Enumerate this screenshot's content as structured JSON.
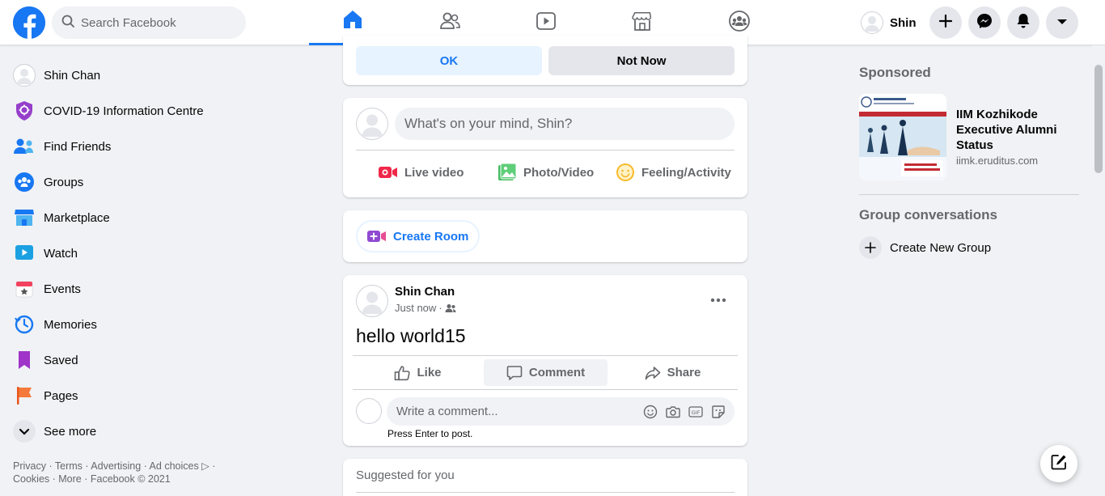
{
  "header": {
    "search": {
      "placeholder": "Search Facebook"
    },
    "nav_tabs": [
      {
        "name": "home",
        "active": true
      },
      {
        "name": "friends",
        "active": false
      },
      {
        "name": "watch",
        "active": false
      },
      {
        "name": "marketplace",
        "active": false
      },
      {
        "name": "groups",
        "active": false
      }
    ],
    "profile_name": "Shin",
    "actions": [
      "create-icon",
      "messenger-icon",
      "notifications-icon",
      "account-menu-icon"
    ]
  },
  "sidebar": {
    "items": [
      {
        "label": "Shin Chan",
        "icon": "profile-avatar"
      },
      {
        "label": "COVID-19 Information Centre",
        "icon": "covid-shield-icon"
      },
      {
        "label": "Find Friends",
        "icon": "friends-icon"
      },
      {
        "label": "Groups",
        "icon": "groups-icon"
      },
      {
        "label": "Marketplace",
        "icon": "marketplace-icon"
      },
      {
        "label": "Watch",
        "icon": "watch-icon"
      },
      {
        "label": "Events",
        "icon": "events-icon"
      },
      {
        "label": "Memories",
        "icon": "memories-icon"
      },
      {
        "label": "Saved",
        "icon": "saved-icon"
      },
      {
        "label": "Pages",
        "icon": "pages-icon"
      },
      {
        "label": "See more",
        "icon": "chevron-down-icon"
      }
    ],
    "footer": {
      "line1": "Privacy · Terms · Advertising · Ad choices ▷ ·",
      "line2": "Cookies · More · Facebook © 2021"
    }
  },
  "prompt_card": {
    "ok_label": "OK",
    "not_now_label": "Not Now"
  },
  "composer": {
    "placeholder": "What's on your mind, Shin?",
    "actions": [
      {
        "label": "Live video",
        "icon": "live-video-icon",
        "color": "#f02849"
      },
      {
        "label": "Photo/Video",
        "icon": "photo-video-icon",
        "color": "#45bd62"
      },
      {
        "label": "Feeling/Activity",
        "icon": "feeling-icon",
        "color": "#f7b928"
      }
    ]
  },
  "room": {
    "label": "Create Room"
  },
  "post": {
    "author": "Shin Chan",
    "time": "Just now",
    "text": "hello world15",
    "actions": {
      "like": "Like",
      "comment": "Comment",
      "share": "Share"
    },
    "comment_placeholder": "Write a comment...",
    "press_enter": "Press Enter to post."
  },
  "suggested": {
    "title": "Suggested for you"
  },
  "right": {
    "sponsored_title": "Sponsored",
    "ad": {
      "title": "IIM Kozhikode Executive Alumni Status",
      "url": "iimk.eruditus.com"
    },
    "group_conv_title": "Group conversations",
    "create_group_label": "Create New Group"
  },
  "colors": {
    "brand": "#1877f2",
    "text": "#050505",
    "secondary": "#65676b",
    "bg": "#f0f2f5"
  }
}
